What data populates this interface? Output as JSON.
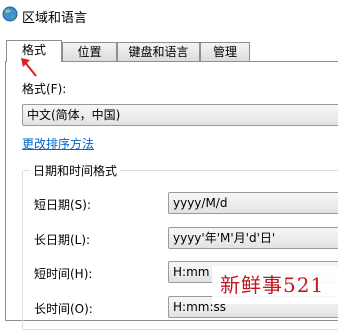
{
  "window": {
    "title": "区域和语言",
    "icon": "globe-icon"
  },
  "tabs": [
    {
      "label": "格式",
      "active": true
    },
    {
      "label": "位置",
      "active": false
    },
    {
      "label": "键盘和语言",
      "active": false
    },
    {
      "label": "管理",
      "active": false
    }
  ],
  "format": {
    "label": "格式(F):",
    "selected": "中文(简体，中国)"
  },
  "sort_link": "更改排序方法",
  "datetime_group": {
    "title": "日期和时间格式",
    "rows": [
      {
        "label": "短日期(S):",
        "value": "yyyy/M/d"
      },
      {
        "label": "长日期(L):",
        "value": "yyyy'年'M'月'd'日'"
      },
      {
        "label": "短时间(H):",
        "value": "H:mm"
      },
      {
        "label": "长时间(O):",
        "value": "H:mm:ss"
      }
    ]
  },
  "annotation": {
    "arrow_color": "#e02020"
  },
  "watermark": "新鲜事521"
}
